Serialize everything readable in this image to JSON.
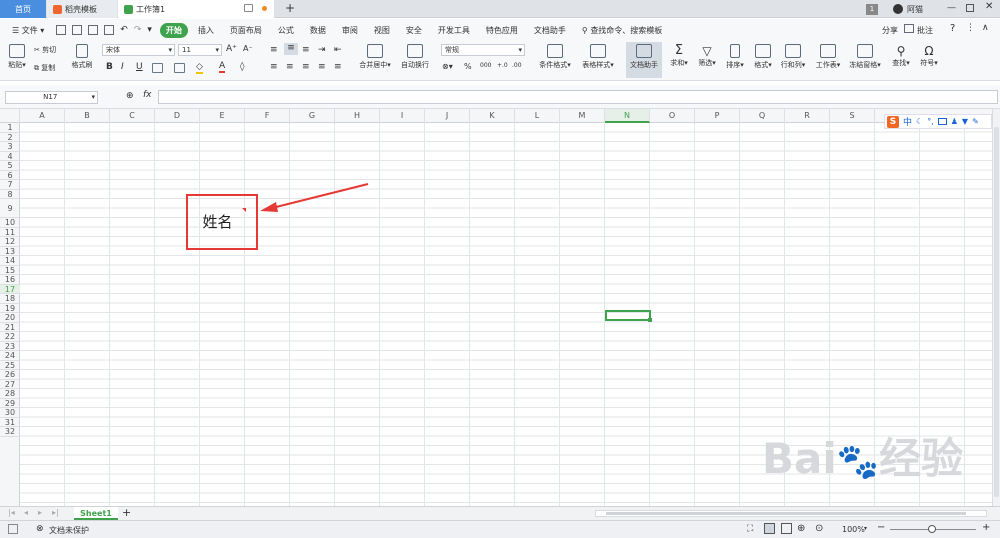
{
  "titlebar": {
    "home_tab": "首页",
    "template_tab": "稻壳模板",
    "workbook_tab": "工作簿1",
    "new_tab": "+",
    "badge": "1",
    "user": "阿猫"
  },
  "menu": {
    "file": "文件",
    "items": [
      "开始",
      "插入",
      "页面布局",
      "公式",
      "数据",
      "审阅",
      "视图",
      "安全",
      "开发工具",
      "特色应用",
      "文档助手"
    ],
    "search_placeholder": "查找命令、搜索模板",
    "share": "分享",
    "comment": "批注",
    "help": "?"
  },
  "ribbon": {
    "paste": "粘贴",
    "cut": "剪切",
    "copy": "复制",
    "format_painter": "格式刷",
    "font_name": "宋体",
    "font_size": "11",
    "merge_center": "合并居中",
    "wrap_text": "自动换行",
    "number_format": "常规",
    "conditional_format": "条件格式",
    "table_style": "表格样式",
    "doc_helper": "文档助手",
    "sum": "求和",
    "filter": "筛选",
    "sort": "排序",
    "format": "格式",
    "row_col": "行和列",
    "worksheet": "工作表",
    "freeze": "冻结窗格",
    "find": "查找",
    "symbol": "符号"
  },
  "formula_bar": {
    "name_box": "N17",
    "fx": "fx",
    "formula": ""
  },
  "grid": {
    "columns": [
      "A",
      "B",
      "C",
      "D",
      "E",
      "F",
      "G",
      "H",
      "I",
      "J",
      "K",
      "L",
      "M",
      "N",
      "O",
      "P",
      "Q",
      "R",
      "S"
    ],
    "rows": [
      "1",
      "2",
      "3",
      "4",
      "5",
      "6",
      "7",
      "8",
      "9",
      "10",
      "11",
      "12",
      "13",
      "14",
      "15",
      "16",
      "17",
      "18",
      "19",
      "20",
      "21",
      "22",
      "23",
      "24",
      "25",
      "26",
      "27",
      "28",
      "29",
      "30",
      "31",
      "32"
    ],
    "selected_col": "N",
    "selected_row": "17",
    "cell_text": "姓名"
  },
  "ime": {
    "label": "中"
  },
  "sheetbar": {
    "sheet_tab": "Sheet1",
    "add_sheet": "+"
  },
  "statusbar": {
    "protect": "文档未保护",
    "zoom": "100%",
    "zoom_minus": "−",
    "zoom_plus": "+"
  },
  "colors": {
    "accent_green": "#3fa34d",
    "annotation_red": "#e53935",
    "home_blue": "#4a8ee0"
  }
}
